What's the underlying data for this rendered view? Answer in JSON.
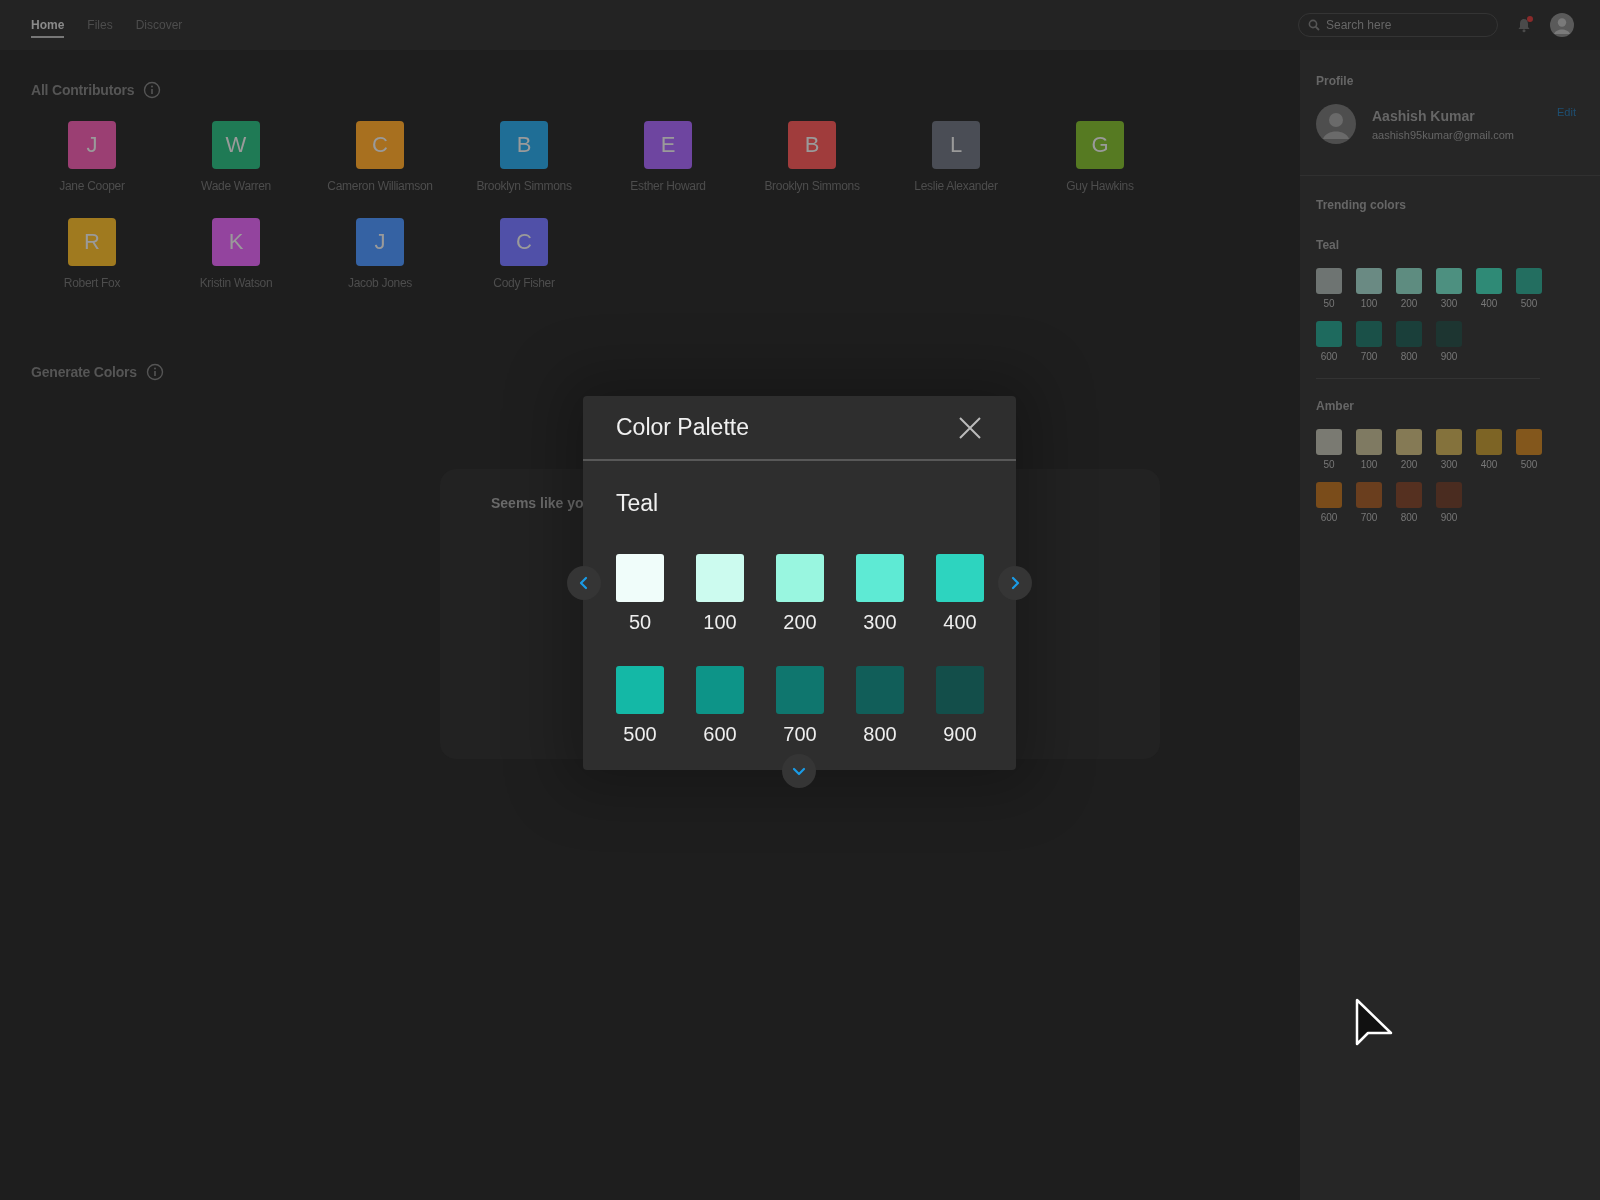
{
  "nav": {
    "tabs": [
      {
        "label": "Home",
        "selected": true
      },
      {
        "label": "Files",
        "selected": false
      },
      {
        "label": "Discover",
        "selected": false
      }
    ],
    "search": {
      "placeholder": "Search here"
    },
    "notifications": {
      "unread": true
    }
  },
  "contributors": {
    "title": "All Contributors",
    "people": [
      {
        "initial": "J",
        "name": "Jane Cooper",
        "color": "#9b3f73"
      },
      {
        "initial": "W",
        "name": "Wade Warren",
        "color": "#1f7a55"
      },
      {
        "initial": "C",
        "name": "Cameron Williamson",
        "color": "#a8701f"
      },
      {
        "initial": "B",
        "name": "Brooklyn Simmons",
        "color": "#1f6e96"
      },
      {
        "initial": "E",
        "name": "Esther Howard",
        "color": "#6e45a0"
      },
      {
        "initial": "B",
        "name": "Brooklyn Simmons",
        "color": "#a03c3c"
      },
      {
        "initial": "L",
        "name": "Leslie Alexander",
        "color": "#4a4d55"
      },
      {
        "initial": "G",
        "name": "Guy Hawkins",
        "color": "#567a22"
      },
      {
        "initial": "R",
        "name": "Robert Fox",
        "color": "#a07a1f"
      },
      {
        "initial": "K",
        "name": "Kristin Watson",
        "color": "#93449e"
      },
      {
        "initial": "J",
        "name": "Jacob Jones",
        "color": "#3562a3"
      },
      {
        "initial": "C",
        "name": "Cody Fisher",
        "color": "#5050a8"
      }
    ]
  },
  "generate_colors": {
    "title": "Generate Colors",
    "message": "Seems like yo"
  },
  "profile": {
    "title": "Profile",
    "name": "Aashish Kumar",
    "email": "aashish95kumar@gmail.com",
    "edit": "Edit"
  },
  "trending_colors": {
    "title": "Trending colors",
    "palettes": [
      {
        "name": "Teal",
        "swatches": [
          {
            "label": "50",
            "color": "#6e7472"
          },
          {
            "label": "100",
            "color": "#6a8a83"
          },
          {
            "label": "200",
            "color": "#5e8c80"
          },
          {
            "label": "300",
            "color": "#4d9080"
          },
          {
            "label": "400",
            "color": "#2f8a76"
          },
          {
            "label": "500",
            "color": "#236e60"
          },
          {
            "label": "600",
            "color": "#1e6a5e"
          },
          {
            "label": "700",
            "color": "#1a5048"
          },
          {
            "label": "800",
            "color": "#1a3f3a"
          },
          {
            "label": "900",
            "color": "#1d3531"
          }
        ]
      },
      {
        "name": "Amber",
        "swatches": [
          {
            "label": "50",
            "color": "#7a7a72"
          },
          {
            "label": "100",
            "color": "#7f7a62"
          },
          {
            "label": "200",
            "color": "#857a55"
          },
          {
            "label": "300",
            "color": "#84723c"
          },
          {
            "label": "400",
            "color": "#7d6425"
          },
          {
            "label": "500",
            "color": "#83571c"
          },
          {
            "label": "600",
            "color": "#7a4c1a"
          },
          {
            "label": "700",
            "color": "#6a3e1e"
          },
          {
            "label": "800",
            "color": "#553020"
          },
          {
            "label": "900",
            "color": "#4a2c20"
          }
        ]
      }
    ]
  },
  "modal": {
    "title": "Color Palette",
    "palette": "Teal",
    "swatches": [
      {
        "label": "50",
        "color": "#f0fdfa"
      },
      {
        "label": "100",
        "color": "#ccfbef"
      },
      {
        "label": "200",
        "color": "#99f6e0"
      },
      {
        "label": "300",
        "color": "#5eead4"
      },
      {
        "label": "400",
        "color": "#2dd4bf"
      },
      {
        "label": "500",
        "color": "#14b8a6"
      },
      {
        "label": "600",
        "color": "#0d9488"
      },
      {
        "label": "700",
        "color": "#0f766e"
      },
      {
        "label": "800",
        "color": "#115e59"
      },
      {
        "label": "900",
        "color": "#134e4a"
      }
    ]
  }
}
